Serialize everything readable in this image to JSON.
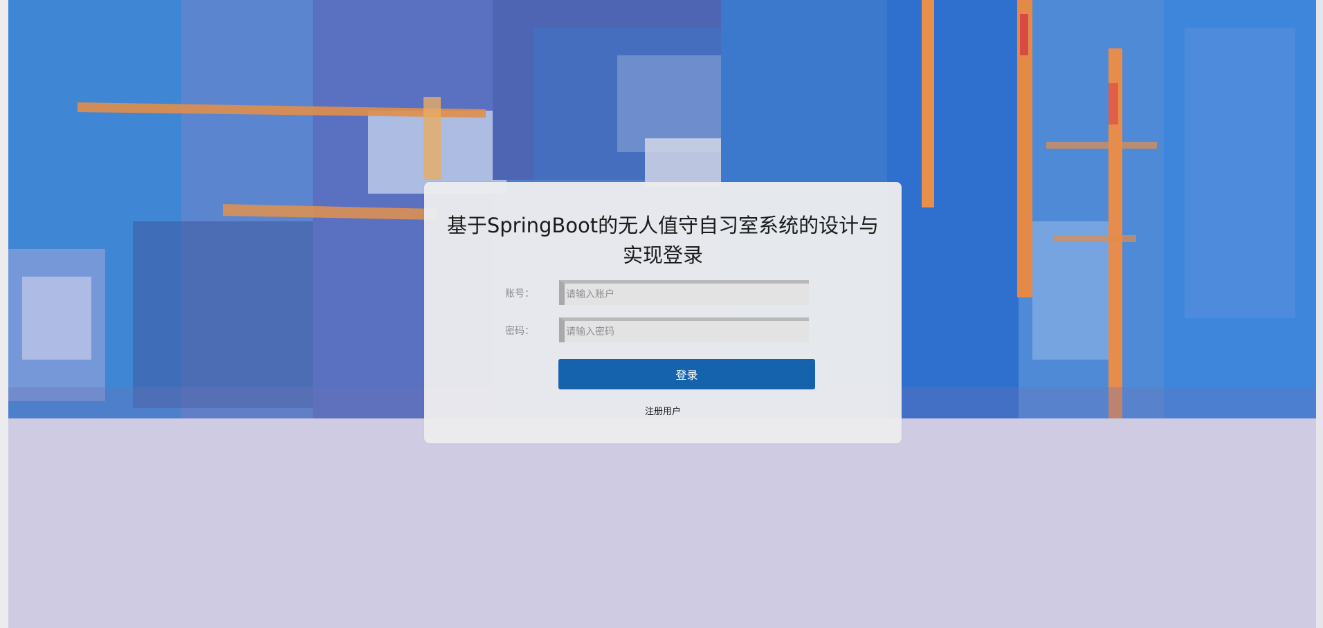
{
  "login": {
    "title": "基于SpringBoot的无人值守自习室系统的设计与实现登录",
    "account_label": "账号：",
    "account_placeholder": "请输入账户",
    "account_value": "",
    "password_label": "密码：",
    "password_placeholder": "请输入密码",
    "password_value": "",
    "submit_label": "登录",
    "register_label": "注册用户"
  },
  "colors": {
    "button": "#1562ad",
    "panel": "#ececee",
    "page_background": "#d0cce4"
  }
}
